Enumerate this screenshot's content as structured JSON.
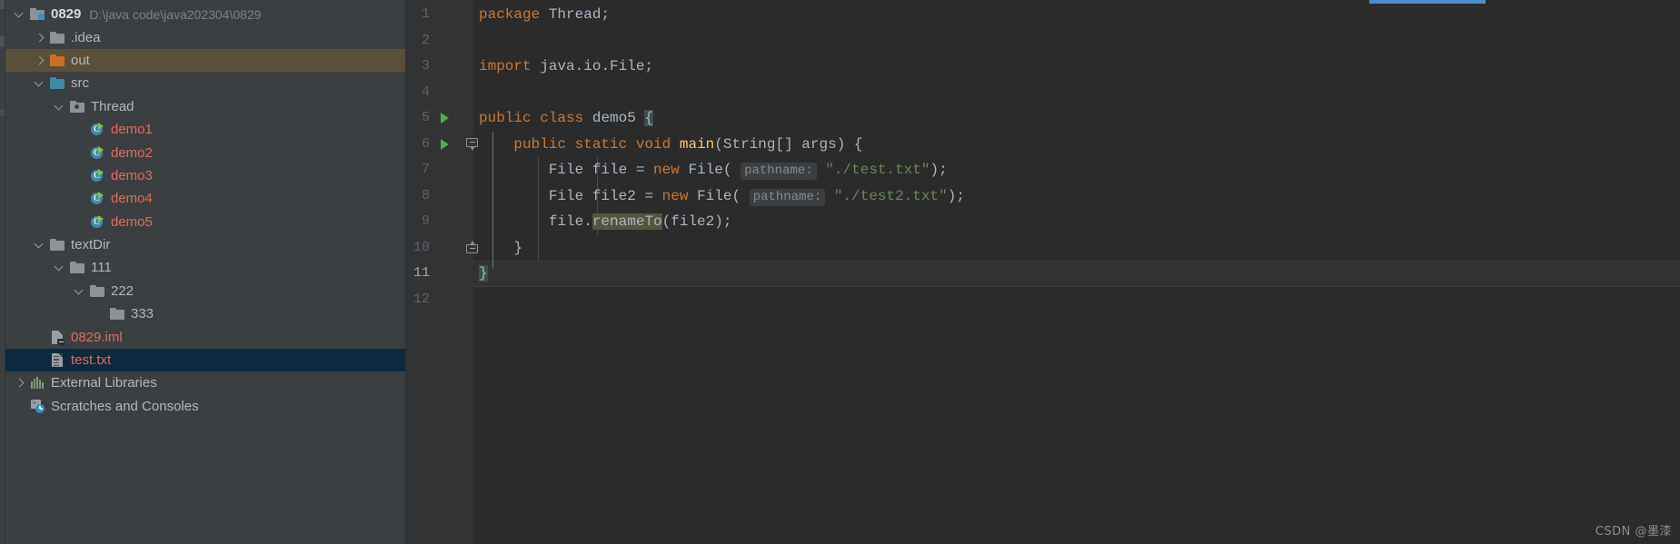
{
  "window": {
    "background": "#2b2b2b",
    "panel_background": "#3c3f41"
  },
  "project_panel": {
    "name": "Project",
    "rows": [
      {
        "indent": 0,
        "twisty": "open",
        "icon": "project-root-icon",
        "label": "0829",
        "style": "bold",
        "note": "D:\\java code\\java202304\\0829",
        "state": "normal"
      },
      {
        "indent": 1,
        "twisty": "closed",
        "icon": "folder-icon",
        "label": ".idea",
        "style": "folder",
        "note": "",
        "state": "normal"
      },
      {
        "indent": 1,
        "twisty": "closed",
        "icon": "folder-orange-icon",
        "label": "out",
        "style": "folder",
        "note": "",
        "state": "hovered"
      },
      {
        "indent": 1,
        "twisty": "open",
        "icon": "folder-source-icon",
        "label": "src",
        "style": "folder",
        "note": "",
        "state": "normal"
      },
      {
        "indent": 2,
        "twisty": "open",
        "icon": "package-icon",
        "label": "Thread",
        "style": "folder",
        "note": "",
        "state": "normal"
      },
      {
        "indent": 3,
        "twisty": "none",
        "icon": "java-class-icon",
        "label": "demo1",
        "style": "java",
        "note": "",
        "state": "normal"
      },
      {
        "indent": 3,
        "twisty": "none",
        "icon": "java-class-icon",
        "label": "demo2",
        "style": "java",
        "note": "",
        "state": "normal"
      },
      {
        "indent": 3,
        "twisty": "none",
        "icon": "java-class-icon",
        "label": "demo3",
        "style": "java",
        "note": "",
        "state": "normal"
      },
      {
        "indent": 3,
        "twisty": "none",
        "icon": "java-class-icon",
        "label": "demo4",
        "style": "java",
        "note": "",
        "state": "normal"
      },
      {
        "indent": 3,
        "twisty": "none",
        "icon": "java-class-icon",
        "label": "demo5",
        "style": "java",
        "note": "",
        "state": "normal"
      },
      {
        "indent": 1,
        "twisty": "open",
        "icon": "folder-icon",
        "label": "textDir",
        "style": "folder",
        "note": "",
        "state": "normal"
      },
      {
        "indent": 2,
        "twisty": "open",
        "icon": "folder-icon",
        "label": "111",
        "style": "folder",
        "note": "",
        "state": "normal"
      },
      {
        "indent": 3,
        "twisty": "open",
        "icon": "folder-icon",
        "label": "222",
        "style": "folder",
        "note": "",
        "state": "normal"
      },
      {
        "indent": 4,
        "twisty": "none",
        "icon": "folder-icon",
        "label": "333",
        "style": "folder",
        "note": "",
        "state": "normal"
      },
      {
        "indent": 1,
        "twisty": "none",
        "icon": "iml-file-icon",
        "label": "0829.iml",
        "style": "redfile",
        "note": "",
        "state": "normal"
      },
      {
        "indent": 1,
        "twisty": "none",
        "icon": "text-file-icon",
        "label": "test.txt",
        "style": "redfile",
        "note": "",
        "state": "selected"
      },
      {
        "indent": 0,
        "twisty": "closed",
        "icon": "external-libraries-icon",
        "label": "External Libraries",
        "style": "plain",
        "note": "",
        "state": "normal"
      },
      {
        "indent": 0,
        "twisty": "none",
        "icon": "scratches-icon",
        "label": "Scratches and Consoles",
        "style": "plain",
        "note": "",
        "state": "normal"
      }
    ]
  },
  "editor": {
    "language": "java",
    "gutter_line_numbers": [
      "1",
      "2",
      "3",
      "4",
      "5",
      "6",
      "7",
      "8",
      "9",
      "10",
      "11",
      "12"
    ],
    "current_line": "11",
    "run_marker_lines": [
      "5",
      "6"
    ],
    "fold_marker_lines": [
      "6",
      "10"
    ],
    "caret_line_number": 11,
    "code_lines": [
      {
        "number": "1",
        "text": "package Thread;"
      },
      {
        "number": "2",
        "text": ""
      },
      {
        "number": "3",
        "text": "import java.io.File;"
      },
      {
        "number": "4",
        "text": ""
      },
      {
        "number": "5",
        "text": "public class demo5 {"
      },
      {
        "number": "6",
        "text": "    public static void main(String[] args) {"
      },
      {
        "number": "7",
        "text": "        File file = new File( pathname: \"./test.txt\");"
      },
      {
        "number": "8",
        "text": "        File file2 = new File( pathname: \"./test2.txt\");"
      },
      {
        "number": "9",
        "text": "        file.renameTo(file2);"
      },
      {
        "number": "10",
        "text": "    }"
      },
      {
        "number": "11",
        "text": "}"
      },
      {
        "number": "12",
        "text": ""
      }
    ],
    "parameter_hints": [
      "pathname:",
      "pathname:"
    ],
    "highlighted_identifier": "renameTo",
    "string_literals": [
      "\"./test.txt\"",
      "\"./test2.txt\""
    ],
    "colors": {
      "keyword": "#cc7832",
      "string": "#6a8759",
      "method_name": "#ffc66d",
      "identifier": "#a9b7c6",
      "line_number": "#606366",
      "current_line_number": "#a4a3a3",
      "editor_background": "#2b2b2b",
      "gutter_background": "#313335",
      "caret_line_background": "#323232",
      "identifier_highlight": "#57553b",
      "selection_background": "#0d293e",
      "hover_background": "#5a4f38"
    }
  },
  "watermark": {
    "text": "CSDN @墨漆"
  }
}
